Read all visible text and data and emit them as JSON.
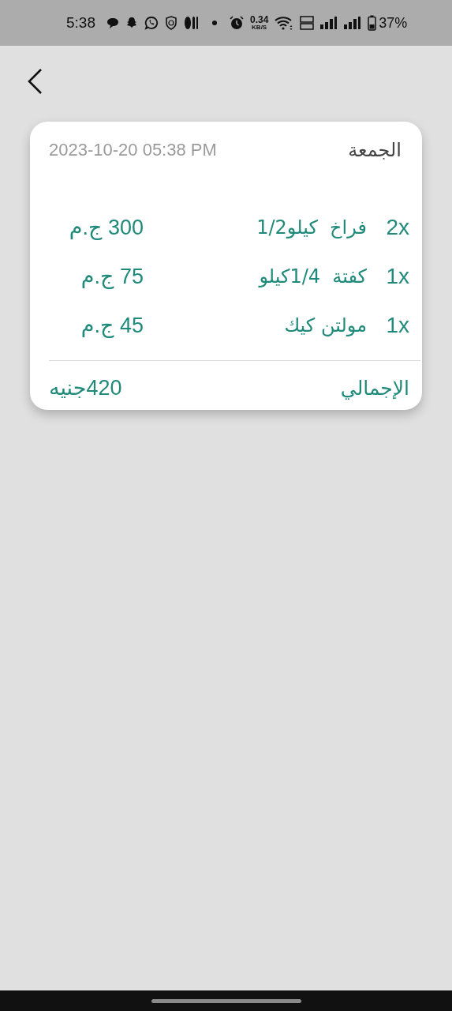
{
  "status_bar": {
    "time": "5:38",
    "speed_value": "0.34",
    "speed_unit": "KB/S",
    "battery": "37%"
  },
  "order": {
    "day": "الجمعة",
    "datetime": "2023-10-20 05:38 PM",
    "items": [
      {
        "quantity": "2x",
        "name": "فراخ  كيلو1/2",
        "price": "300 ج.م"
      },
      {
        "quantity": "1x",
        "name": "كفتة  1/4كيلو",
        "price": "75 ج.م"
      },
      {
        "quantity": "1x",
        "name": "مولتن كيك",
        "price": "45 ج.م"
      }
    ],
    "total_label": "الإجمالي",
    "total": "420جنيه"
  }
}
